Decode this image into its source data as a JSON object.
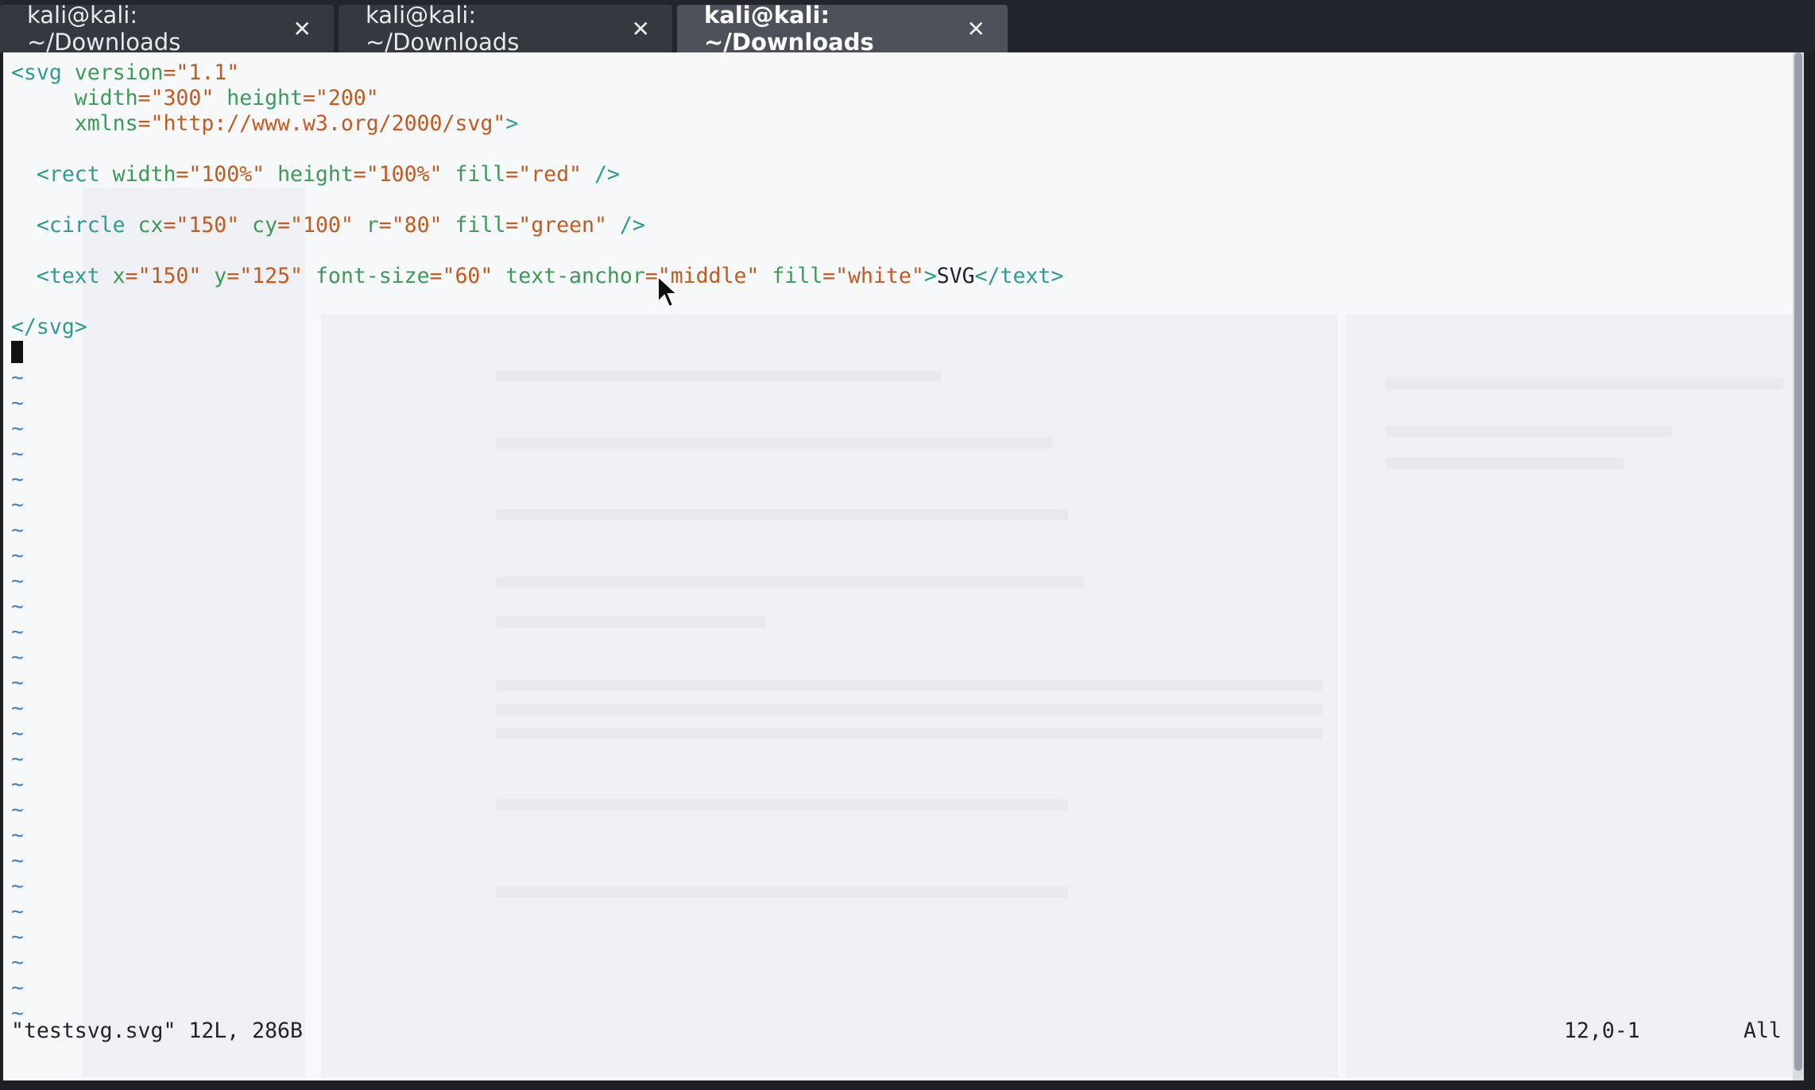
{
  "tabs": [
    {
      "label": "kali@kali: ~/Downloads",
      "active": false
    },
    {
      "label": "kali@kali: ~/Downloads",
      "active": false
    },
    {
      "label": "kali@kali: ~/Downloads",
      "active": true
    }
  ],
  "tab_close_glyph": "✕",
  "editor": {
    "lines": [
      [
        {
          "t": "<svg ",
          "c": "tag"
        },
        {
          "t": "version",
          "c": "attr"
        },
        {
          "t": "=\"1.1\"",
          "c": "val"
        }
      ],
      [
        {
          "t": "     width",
          "c": "attr"
        },
        {
          "t": "=\"300\" ",
          "c": "val"
        },
        {
          "t": "height",
          "c": "attr"
        },
        {
          "t": "=\"200\"",
          "c": "val"
        }
      ],
      [
        {
          "t": "     xmlns",
          "c": "attr"
        },
        {
          "t": "=\"http://www.w3.org/2000/svg\"",
          "c": "val"
        },
        {
          "t": ">",
          "c": "tag"
        }
      ],
      [],
      [
        {
          "t": "  <rect ",
          "c": "tag"
        },
        {
          "t": "width",
          "c": "attr"
        },
        {
          "t": "=\"100%\" ",
          "c": "val"
        },
        {
          "t": "height",
          "c": "attr"
        },
        {
          "t": "=\"100%\" ",
          "c": "val"
        },
        {
          "t": "fill",
          "c": "attr"
        },
        {
          "t": "=\"red\" ",
          "c": "val"
        },
        {
          "t": "/>",
          "c": "tag"
        }
      ],
      [],
      [
        {
          "t": "  <circle ",
          "c": "tag"
        },
        {
          "t": "cx",
          "c": "attr"
        },
        {
          "t": "=\"150\" ",
          "c": "val"
        },
        {
          "t": "cy",
          "c": "attr"
        },
        {
          "t": "=\"100\" ",
          "c": "val"
        },
        {
          "t": "r",
          "c": "attr"
        },
        {
          "t": "=\"80\" ",
          "c": "val"
        },
        {
          "t": "fill",
          "c": "attr"
        },
        {
          "t": "=\"green\" ",
          "c": "val"
        },
        {
          "t": "/>",
          "c": "tag"
        }
      ],
      [],
      [
        {
          "t": "  <text ",
          "c": "tag"
        },
        {
          "t": "x",
          "c": "attr"
        },
        {
          "t": "=\"150\" ",
          "c": "val"
        },
        {
          "t": "y",
          "c": "attr"
        },
        {
          "t": "=\"125\" ",
          "c": "val"
        },
        {
          "t": "font-size",
          "c": "attr"
        },
        {
          "t": "=\"60\" ",
          "c": "val"
        },
        {
          "t": "text-anchor",
          "c": "attr"
        },
        {
          "t": "=\"middle\" ",
          "c": "val"
        },
        {
          "t": "fill",
          "c": "attr"
        },
        {
          "t": "=\"white\"",
          "c": "val"
        },
        {
          "t": ">",
          "c": "tag"
        },
        {
          "t": "SVG",
          "c": "txt"
        },
        {
          "t": "</text>",
          "c": "tag"
        }
      ],
      [],
      [
        {
          "t": "</svg>",
          "c": "tag"
        }
      ]
    ],
    "empty_line_marker": "~",
    "empty_line_count": 26
  },
  "status": {
    "file_info": "\"testsvg.svg\" 12L, 286B",
    "position": "12,0-1",
    "scroll": "All"
  },
  "colors": {
    "tag": "#2d9c92",
    "attr": "#3c9a57",
    "value": "#c45a1f",
    "tilde": "#4a7fd6"
  }
}
